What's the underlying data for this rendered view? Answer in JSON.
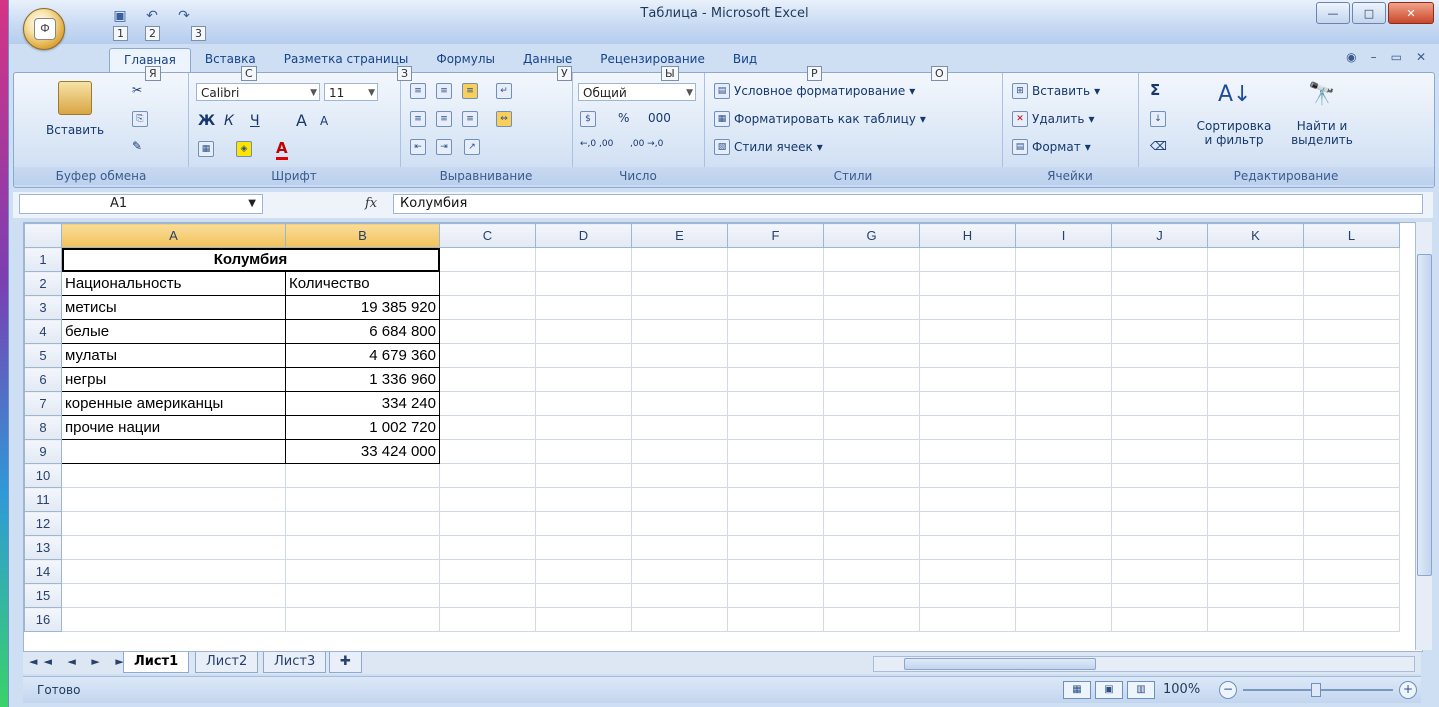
{
  "window": {
    "title": "Таблица - Microsoft Excel"
  },
  "qat_keytips": [
    "1",
    "2",
    "3"
  ],
  "tabs": [
    {
      "label": "Главная",
      "keytip": "Я",
      "active": true
    },
    {
      "label": "Вставка",
      "keytip": "С"
    },
    {
      "label": "Разметка страницы",
      "keytip": "З"
    },
    {
      "label": "Формулы",
      "keytip": "У"
    },
    {
      "label": "Данные",
      "keytip": "Ы"
    },
    {
      "label": "Рецензирование",
      "keytip": "Р"
    },
    {
      "label": "Вид",
      "keytip": "О"
    }
  ],
  "ribbon": {
    "clipboard": {
      "label": "Буфер обмена",
      "paste": "Вставить"
    },
    "font": {
      "label": "Шрифт",
      "name": "Calibri",
      "size": "11",
      "bold": "Ж",
      "italic": "К",
      "underline": "Ч",
      "grow": "A",
      "shrink": "A"
    },
    "alignment": {
      "label": "Выравнивание"
    },
    "number": {
      "label": "Число",
      "format": "Общий",
      "percent": "%",
      "thousands": "000",
      "inc": "←,0 ,00",
      "dec": ",00 →,0"
    },
    "styles": {
      "label": "Стили",
      "conditional": "Условное форматирование",
      "as_table": "Форматировать как таблицу",
      "cell_styles": "Стили ячеек"
    },
    "cells": {
      "label": "Ячейки",
      "insert": "Вставить",
      "delete": "Удалить",
      "format": "Формат"
    },
    "editing": {
      "label": "Редактирование",
      "sum": "Σ",
      "sort": "Сортировка и фильтр",
      "find": "Найти и выделить"
    }
  },
  "formula_bar": {
    "name_box": "A1",
    "fx": "fx",
    "value": "Колумбия"
  },
  "columns": [
    "A",
    "B",
    "C",
    "D",
    "E",
    "F",
    "G",
    "H",
    "I",
    "J",
    "K",
    "L"
  ],
  "rows": [
    {
      "n": "1",
      "a": "Колумбия",
      "b": ""
    },
    {
      "n": "2",
      "a": "Национальность",
      "b": "Количество"
    },
    {
      "n": "3",
      "a": "метисы",
      "b": "19 385 920"
    },
    {
      "n": "4",
      "a": "белые",
      "b": "6 684 800"
    },
    {
      "n": "5",
      "a": "мулаты",
      "b": "4 679 360"
    },
    {
      "n": "6",
      "a": "негры",
      "b": "1 336 960"
    },
    {
      "n": "7",
      "a": "коренные американцы",
      "b": "334 240"
    },
    {
      "n": "8",
      "a": "прочие нации",
      "b": "1 002 720"
    },
    {
      "n": "9",
      "a": "",
      "b": "33 424 000"
    },
    {
      "n": "10",
      "a": "",
      "b": ""
    },
    {
      "n": "11",
      "a": "",
      "b": ""
    },
    {
      "n": "12",
      "a": "",
      "b": ""
    },
    {
      "n": "13",
      "a": "",
      "b": ""
    },
    {
      "n": "14",
      "a": "",
      "b": ""
    },
    {
      "n": "15",
      "a": "",
      "b": ""
    },
    {
      "n": "16",
      "a": "",
      "b": ""
    }
  ],
  "sheets": [
    "Лист1",
    "Лист2",
    "Лист3"
  ],
  "status": {
    "ready": "Готово",
    "zoom": "100%"
  }
}
